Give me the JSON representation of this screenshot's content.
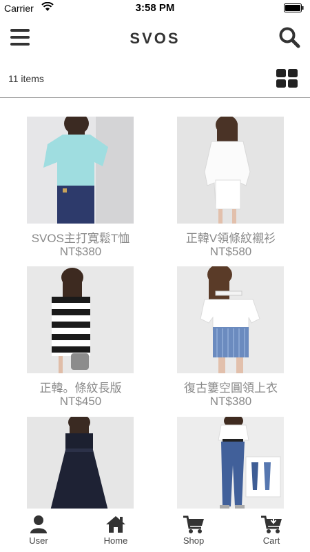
{
  "status_bar": {
    "carrier": "Carrier",
    "time": "3:58 PM"
  },
  "header": {
    "brand": "SVOS"
  },
  "filter": {
    "count": "11 items"
  },
  "products": [
    {
      "name": "SVOS主打寬鬆T恤",
      "price": "NT$380"
    },
    {
      "name": "正韓V領條紋襯衫",
      "price": "NT$580"
    },
    {
      "name": "正韓。條紋長版",
      "price": "NT$450"
    },
    {
      "name": "復古簍空圓領上衣",
      "price": "NT$380"
    },
    {
      "name": "",
      "price": ""
    },
    {
      "name": "",
      "price": ""
    }
  ],
  "tabs": [
    {
      "label": "User",
      "icon": "user-icon"
    },
    {
      "label": "Home",
      "icon": "home-icon"
    },
    {
      "label": "Shop",
      "icon": "cart-icon"
    },
    {
      "label": "Cart",
      "icon": "cart-download-icon"
    }
  ]
}
